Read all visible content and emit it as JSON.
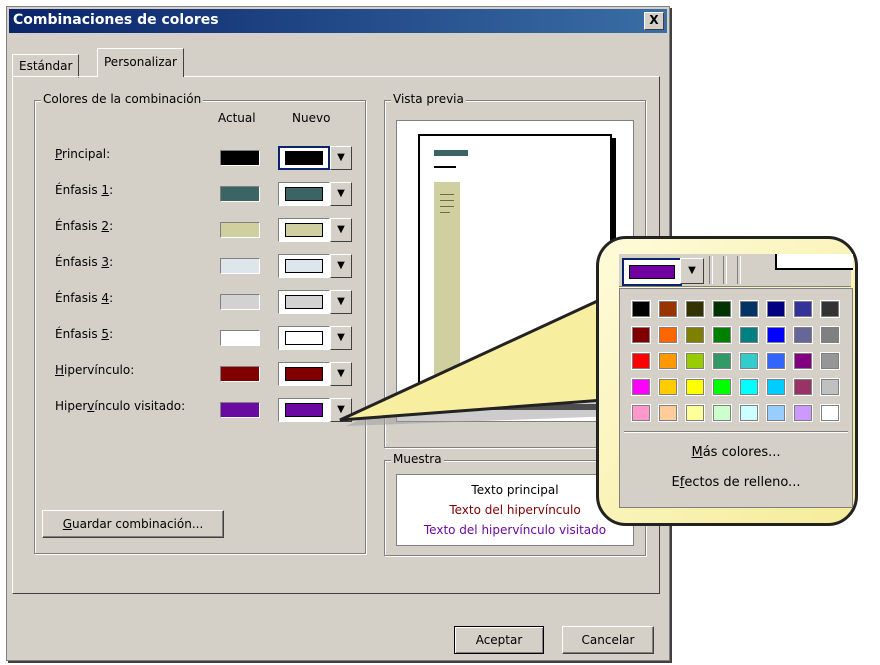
{
  "dialog": {
    "title": "Combinaciones de colores",
    "close_label": "X",
    "tabs": [
      "Estándar",
      "Personalizar"
    ],
    "active_tab": "Personalizar"
  },
  "colors_group": {
    "legend": "Colores de la combinación",
    "col_current": "Actual",
    "col_new": "Nuevo",
    "rows": [
      {
        "pre": "",
        "key": "P",
        "post": "rincipal:",
        "current": "#000000",
        "new": "#000000"
      },
      {
        "pre": "Énfasis ",
        "key": "1",
        "post": ":",
        "current": "#3a6564",
        "new": "#3a6564"
      },
      {
        "pre": "Énfasis ",
        "key": "2",
        "post": ":",
        "current": "#cfcf9f",
        "new": "#cfcf9f"
      },
      {
        "pre": "Énfasis ",
        "key": "3",
        "post": ":",
        "current": "#dde6ea",
        "new": "#dde6ea"
      },
      {
        "pre": "Énfasis ",
        "key": "4",
        "post": ":",
        "current": "#d2d2d2",
        "new": "#d2d2d2"
      },
      {
        "pre": "Énfasis ",
        "key": "5",
        "post": ":",
        "current": "#ffffff",
        "new": "#ffffff"
      },
      {
        "pre": "",
        "key": "H",
        "post": "ipervínculo:",
        "current": "#800000",
        "new": "#800000"
      },
      {
        "pre": "Hiper",
        "key": "v",
        "post": "ínculo visitado:",
        "current": "#6a0aa0",
        "new": "#6a0aa0"
      }
    ],
    "save_pre": "",
    "save_key": "G",
    "save_post": "uardar combinación..."
  },
  "preview_group": {
    "legend": "Vista previa"
  },
  "muestra_group": {
    "legend": "Muestra",
    "text_main": "Texto principal",
    "text_link": "Texto del hipervínculo",
    "text_visited": "Texto del hipervínculo visitado",
    "color_main": "#000000",
    "color_link": "#800000",
    "color_visited": "#6a0aa0"
  },
  "buttons": {
    "ok": "Aceptar",
    "cancel": "Cancelar"
  },
  "popup": {
    "selected_color": "#7000a0",
    "palette": [
      [
        "#000000",
        "#993300",
        "#333300",
        "#003300",
        "#003366",
        "#000080",
        "#333399",
        "#333333"
      ],
      [
        "#800000",
        "#ff6600",
        "#808000",
        "#008000",
        "#008080",
        "#0000ff",
        "#666699",
        "#808080"
      ],
      [
        "#ff0000",
        "#ff9900",
        "#99cc00",
        "#339966",
        "#33cccc",
        "#3366ff",
        "#800080",
        "#969696"
      ],
      [
        "#ff00ff",
        "#ffcc00",
        "#ffff00",
        "#00ff00",
        "#00ffff",
        "#00ccff",
        "#993366",
        "#c0c0c0"
      ],
      [
        "#ff99cc",
        "#ffcc99",
        "#ffff99",
        "#ccffcc",
        "#ccffff",
        "#99ccff",
        "#cc99ff",
        "#ffffff"
      ]
    ],
    "more_pre": "",
    "more_key": "M",
    "more_post": "ás colores...",
    "fill_pre": "E",
    "fill_key": "f",
    "fill_post": "ectos de relleno..."
  }
}
